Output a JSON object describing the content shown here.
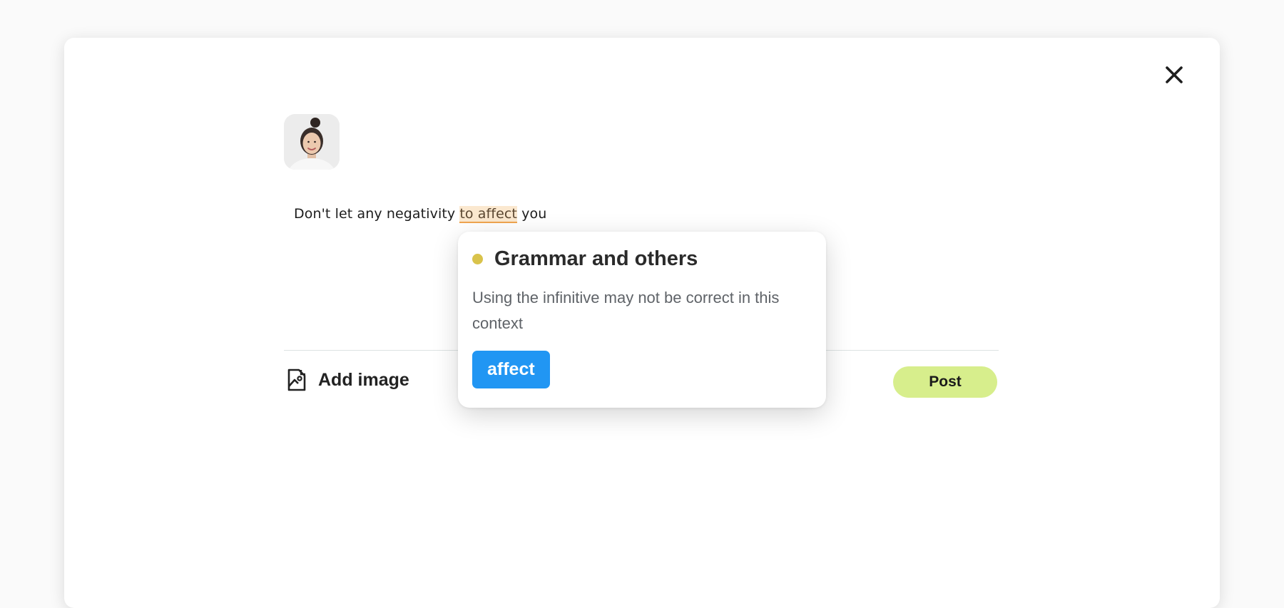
{
  "composer": {
    "close_icon": "close-icon",
    "avatar_icon": "user-avatar",
    "text": {
      "before": "Don't let any negativity ",
      "flagged": "to affect",
      "after": " you"
    },
    "add_image": {
      "icon": "image-add-icon",
      "label": "Add image"
    },
    "post_label": "Post"
  },
  "suggestion_popup": {
    "category": "Grammar and others",
    "category_color": "#d9c34b",
    "message": "Using the infinitive may not be correct in this context",
    "replacement": "affect",
    "replacement_color": "#2196f3"
  },
  "colors": {
    "post_button": "#d7ee8c",
    "highlight_bg": "#fbe8cf",
    "highlight_underline": "#f0a54f"
  }
}
